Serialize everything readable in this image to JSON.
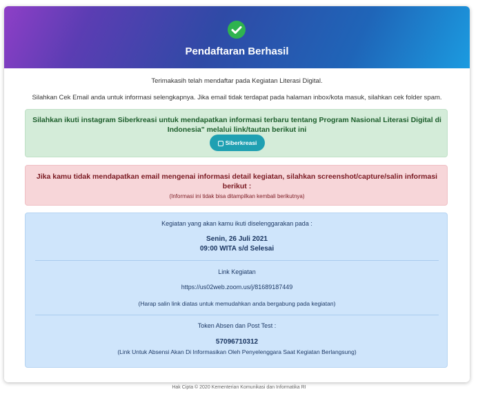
{
  "header": {
    "title": "Pendaftaran Berhasil",
    "icon": "check-circle-icon",
    "check_color": "#2fb34f"
  },
  "intro": {
    "line1": "Terimakasih telah mendaftar pada Kegiatan Literasi Digital.",
    "line2": "Silahkan Cek Email anda untuk informasi selengkapnya. Jika email tidak terdapat pada halaman inbox/kota masuk, silahkan cek folder spam."
  },
  "instagram_box": {
    "text": "Silahkan ikuti instagram Siberkreasi untuk mendapatkan informasi terbaru tentang Program Nasional Literasi Digital di Indonesia\" melalui link/tautan berikut ini",
    "button_label": "Siberkreasi",
    "button_icon": "instagram-icon",
    "button_color": "#1fa0b2"
  },
  "warning_box": {
    "text": "Jika kamu tidak mendapatkan email mengenai informasi detail kegiatan, silahkan screenshot/capture/salin informasi berikut :",
    "note": "(Informasi ini tidak bisa ditampilkan kembali berikutnya)"
  },
  "info_box": {
    "schedule_label": "Kegiatan yang akan kamu ikuti diselenggarakan pada :",
    "date": "Senin, 26 Juli 2021",
    "time": "09:00 WITA s/d Selesai",
    "link_label": "Link Kegiatan",
    "link_url": "https://us02web.zoom.us/j/81689187449",
    "link_note": "(Harap salin link diatas untuk memudahkan anda bergabung pada kegiatan)",
    "token_label": "Token Absen dan Post Test :",
    "token": "57096710312",
    "token_note": "(Link Untuk Absensi Akan Di Informasikan Oleh Penyelenggara Saat Kegiatan Berlangsung)"
  },
  "footer": {
    "copyright": "Hak Cipta © 2020 Kementerian Komunikasi dan Informatika RI"
  }
}
